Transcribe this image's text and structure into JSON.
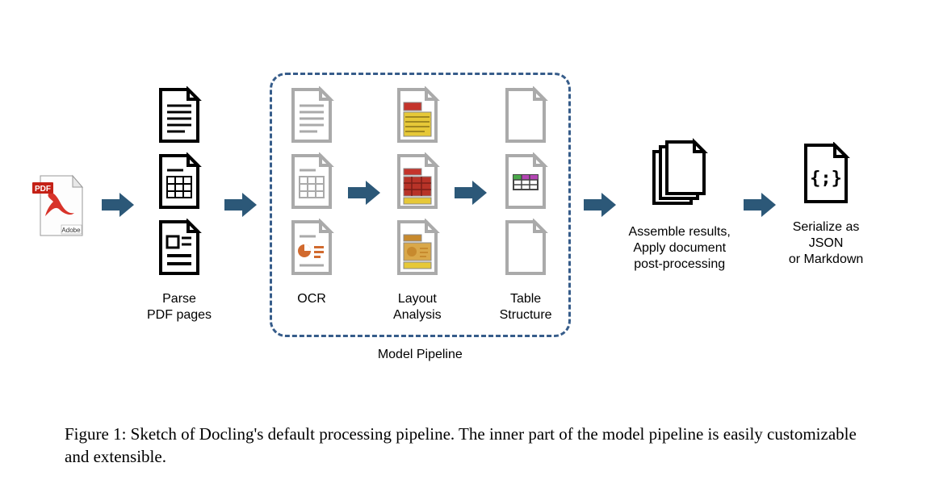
{
  "stages": {
    "input": {
      "badge": "PDF",
      "vendor": "Adobe"
    },
    "parse": {
      "label": "Parse\nPDF pages"
    },
    "pipeline": {
      "label": "Model Pipeline",
      "ocr": {
        "label": "OCR"
      },
      "layout": {
        "label": "Layout\nAnalysis"
      },
      "table": {
        "label": "Table\nStructure"
      }
    },
    "assemble": {
      "label": "Assemble results,\nApply document\npost-processing"
    },
    "serialize": {
      "label": "Serialize as\nJSON\nor Markdown"
    }
  },
  "caption": "Figure 1: Sketch of Docling's default processing pipeline. The inner part of the model pipeline is easily customizable and extensible."
}
